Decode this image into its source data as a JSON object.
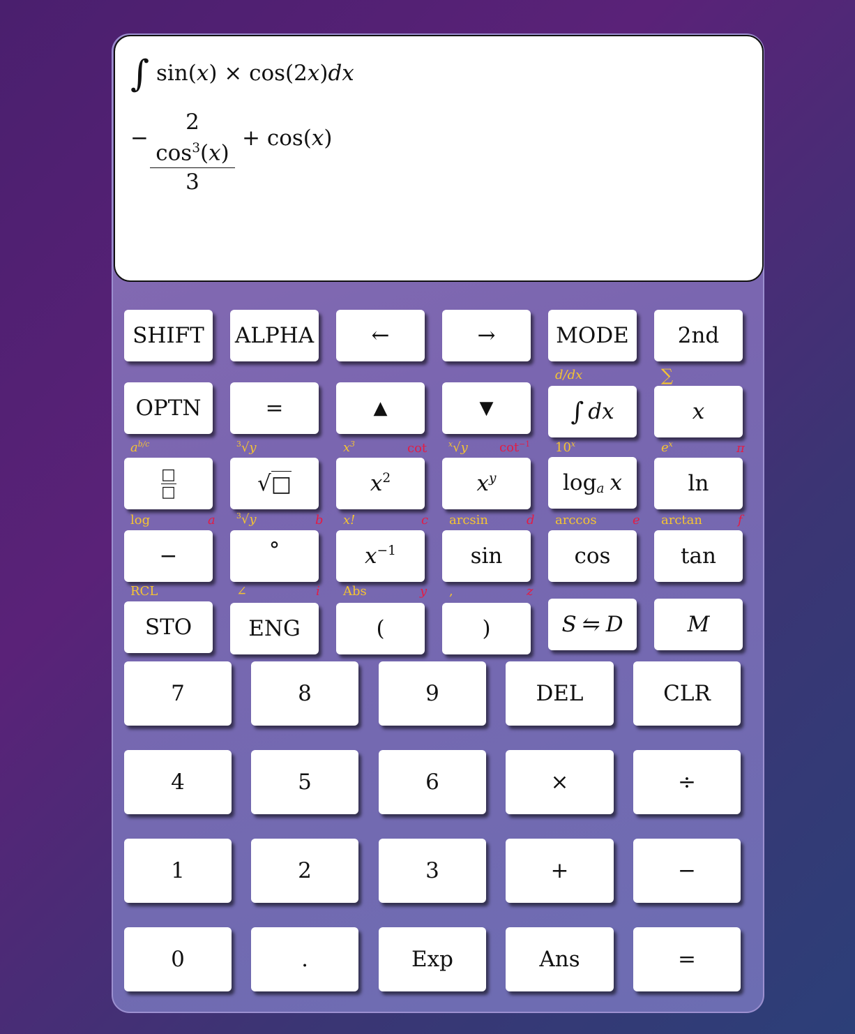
{
  "display": {
    "input": {
      "integral_sign": "∫",
      "part1": "sin(",
      "var": "x",
      "part2": ") × cos(2",
      "var2": "x",
      "part3": ")",
      "dx": "dx"
    },
    "result": {
      "minus": "−",
      "num_pre": "2 cos",
      "num_exp": "3",
      "num_open": "(",
      "num_var": "x",
      "num_close": ")",
      "den": "3",
      "plus": "+ cos(",
      "var": "x",
      "close": ")"
    }
  },
  "keys": {
    "shift": "SHIFT",
    "alpha": "ALPHA",
    "left": "←",
    "right": "→",
    "mode": "MODE",
    "second": "2nd",
    "optn": "OPTN",
    "equals_top": "=",
    "up": "▲",
    "down": "▼",
    "integral_sign": "∫",
    "integral_dx": "dx",
    "x": "x",
    "frac_glyph": "□",
    "sqrt": "√",
    "sqrt_box": "□",
    "x2_base": "x",
    "x2_exp": "2",
    "xy_base": "x",
    "xy_exp": "y",
    "log_pre": "log",
    "log_sub": "a",
    "log_var": "x",
    "ln": "ln",
    "neg": "−",
    "degree": "°",
    "xinv_base": "x",
    "xinv_exp": "−1",
    "sin": "sin",
    "cos": "cos",
    "tan": "tan",
    "sto": "STO",
    "eng": "ENG",
    "lparen": "(",
    "rparen": ")",
    "sd_s": "S",
    "sd_arrow": "⇋",
    "sd_d": "D",
    "m": "M",
    "n7": "7",
    "n8": "8",
    "n9": "9",
    "del": "DEL",
    "clr": "CLR",
    "n4": "4",
    "n5": "5",
    "n6": "6",
    "mul": "×",
    "div": "÷",
    "n1": "1",
    "n2": "2",
    "n3": "3",
    "plus": "+",
    "minus": "−",
    "n0": "0",
    "dot": ".",
    "exp": "Exp",
    "ans": "Ans",
    "equals": "="
  },
  "shift_labels": {
    "deriv": "d/dx",
    "sum": "∑",
    "abc_base": "a",
    "abc_exp": "b/c",
    "cbrt_idx": "3",
    "cbrt_rad": "√",
    "cbrt_var": "y",
    "x3_base": "x",
    "x3_exp": "3",
    "cot": "cot",
    "xroot_idx": "x",
    "xroot_rad": "√",
    "xroot_var": "y",
    "acot_pre": "cot",
    "acot_exp": "−1",
    "pow10_base": "10",
    "pow10_exp": "x",
    "exp_base": "e",
    "exp_exp": "x",
    "log": "log",
    "cbrt2_idx": "3",
    "cbrt2_rad": "√",
    "cbrt2_var": "y",
    "fact": "x!",
    "arcsin": "arcsin",
    "arccos": "arccos",
    "arctan": "arctan",
    "rcl": "RCL",
    "angle": "∠",
    "abs": "Abs",
    "comma": ","
  },
  "alpha_labels": {
    "pi": "π",
    "a": "a",
    "b": "b",
    "c": "c",
    "d": "d",
    "e": "e",
    "f": "f",
    "i": "i",
    "y": "y",
    "z": "z"
  },
  "colors": {
    "shift": "#f5c431",
    "alpha": "#e31c45",
    "key_bg": "#ffffff"
  }
}
